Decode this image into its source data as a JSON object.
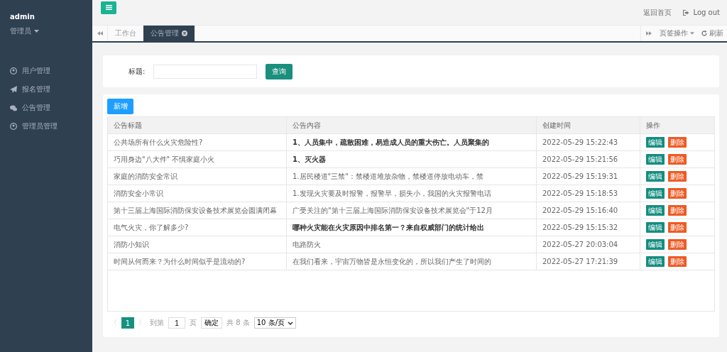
{
  "sidebar": {
    "user": "admin",
    "role": "管理员",
    "items": [
      {
        "label": "用户管理"
      },
      {
        "label": "报名管理"
      },
      {
        "label": "公告管理"
      },
      {
        "label": "管理员管理"
      }
    ]
  },
  "topbar": {
    "home": "返回首页",
    "logout": "Log out"
  },
  "tabs": [
    {
      "label": "工作台",
      "selected": false
    },
    {
      "label": "公告管理",
      "selected": true
    }
  ],
  "tab_tools": {
    "page_ops": "页签操作",
    "refresh": "刷新"
  },
  "search": {
    "label": "标题:",
    "button": "查询"
  },
  "add_button": "新增",
  "table": {
    "columns": [
      "公告标题",
      "公告内容",
      "创建时间",
      "操作"
    ],
    "rows": [
      {
        "title": "公共场所有什么火灾危险性?",
        "content": "1、人员集中，疏散困难，易造成人员的重大伤亡。人员聚集的",
        "bold": true,
        "time": "2022-05-29 15:22:43",
        "edit": "编辑",
        "delete": "删除"
      },
      {
        "title": "巧用身边\"八大件\" 不惧家庭小火",
        "content": "1、灭火器",
        "bold": true,
        "time": "2022-05-29 15:21:56",
        "edit": "编辑",
        "delete": "删除"
      },
      {
        "title": "家庭的消防安全常识",
        "content": "1.居民楼道\"三禁\"：禁楼道堆放杂物，禁楼道停放电动车，禁",
        "bold": false,
        "time": "2022-05-29 15:19:31",
        "edit": "编辑",
        "delete": "删除"
      },
      {
        "title": "消防安全小常识",
        "content": "1.发现火灾要及时报警，报警早，损失小，我国的火灾报警电话",
        "bold": false,
        "time": "2022-05-29 15:18:53",
        "edit": "编辑",
        "delete": "删除"
      },
      {
        "title": "第十三届上海国际消防保安设备技术展览会圆满闭幕",
        "content": "广受关注的\"第十三届上海国际消防保安设备技术展览会\"于12月",
        "bold": false,
        "time": "2022-05-29 15:16:40",
        "edit": "编辑",
        "delete": "删除"
      },
      {
        "title": "电气火灾，你了解多少?",
        "content": "哪种火灾能在火灾原因中排名第一？来自权威部门的统计给出",
        "bold": true,
        "time": "2022-05-29 15:15:32",
        "edit": "编辑",
        "delete": "删除"
      },
      {
        "title": "消防小知识",
        "content": "电路防火",
        "bold": false,
        "time": "2022-05-27 20:03:04",
        "edit": "编辑",
        "delete": "删除"
      },
      {
        "title": "时间从何而来？为什么时间似乎是流动的?",
        "content": "在我们看来，宇宙万物皆是永恒变化的，所以我们产生了时间的",
        "bold": false,
        "time": "2022-05-27 17:21:39",
        "edit": "编辑",
        "delete": "删除"
      }
    ]
  },
  "pager": {
    "prev": "〈",
    "pages": [
      {
        "label": "1",
        "selected": true
      }
    ],
    "next": "〉",
    "goto": "到第",
    "page_value": "1",
    "page_unit": "页",
    "confirm": "确定",
    "total": "共 8 条",
    "page_size": "10 条/页"
  }
}
